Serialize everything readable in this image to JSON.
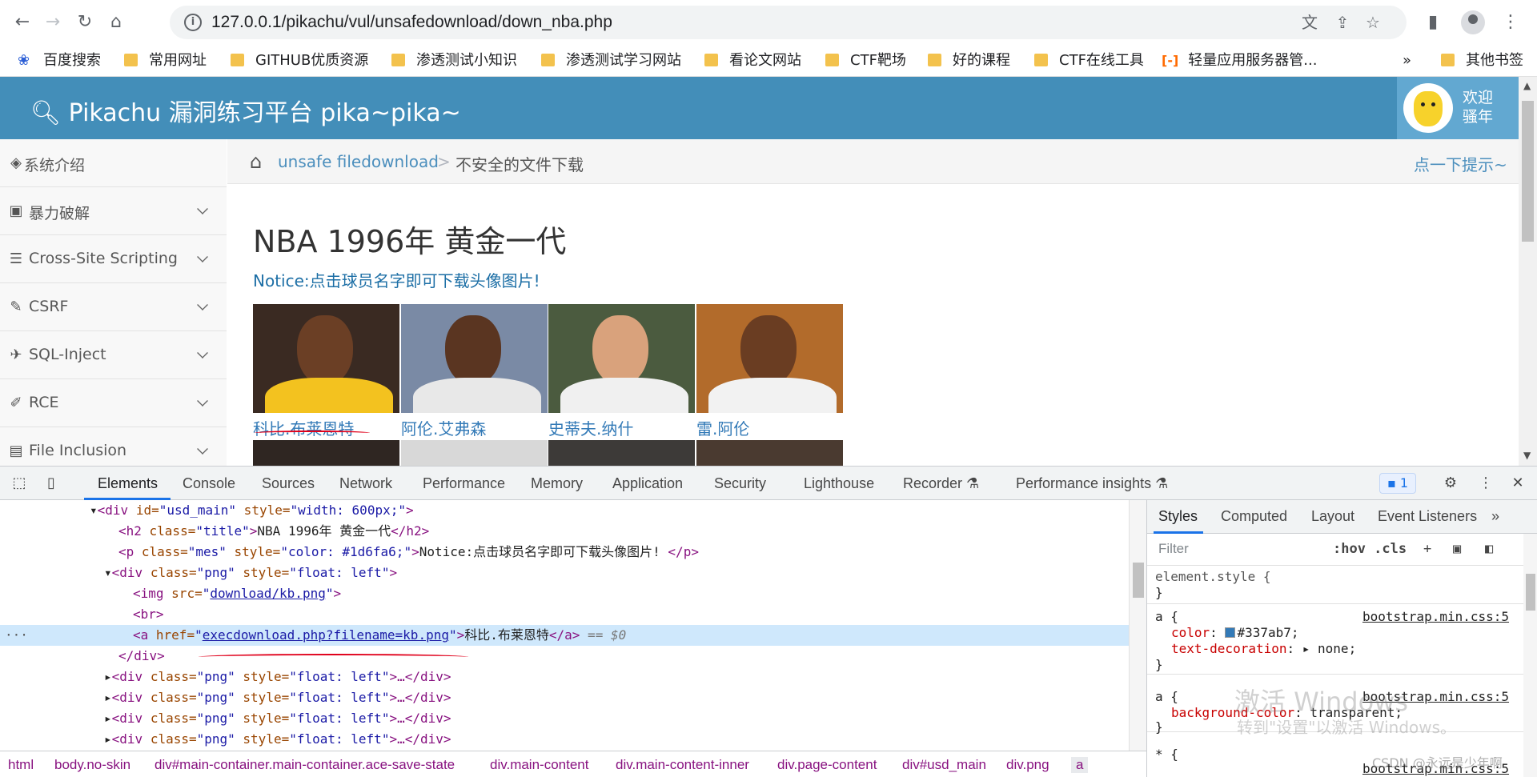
{
  "browser": {
    "url": "127.0.0.1/pikachu/vul/unsafedownload/down_nba.php",
    "bookmarks": [
      "百度搜索",
      "常用网址",
      "GITHUB优质资源",
      "渗透测试小知识",
      "渗透测试学习网站",
      "看论文网站",
      "CTF靶场",
      "好的课程",
      "CTF在线工具",
      "轻量应用服务器管...",
      "其他书签"
    ],
    "more_label": "»"
  },
  "site": {
    "title": "Pikachu 漏洞练习平台 pika~pika~",
    "welcome": "欢迎 骚年",
    "sidebar": [
      "系统介绍",
      "暴力破解",
      "Cross-Site Scripting",
      "CSRF",
      "SQL-Inject",
      "RCE",
      "File Inclusion"
    ],
    "breadcrumb": {
      "section": "unsafe filedownload",
      "sep": ">",
      "page": "不安全的文件下载",
      "hint": "点一下提示~"
    },
    "heading": "NBA 1996年 黄金一代",
    "notice": "Notice:点击球员名字即可下载头像图片!",
    "players": [
      "科比.布莱恩特",
      "阿伦.艾弗森",
      "史蒂夫.纳什",
      "雷.阿伦"
    ]
  },
  "devtools": {
    "tabs": [
      "Elements",
      "Console",
      "Sources",
      "Network",
      "Performance",
      "Memory",
      "Application",
      "Security",
      "Lighthouse",
      "Recorder",
      "Performance insights"
    ],
    "issues_count": "1",
    "dom": {
      "l1_tag": "<div ",
      "l1_attr1": "id=",
      "l1_val1": "\"usd_main\"",
      "l1_attr2": " style=",
      "l1_val2": "\"width: 600px;\"",
      "l1_end": ">",
      "l2_open": "<h2 ",
      "l2_attr": "class=",
      "l2_val": "\"title\"",
      "l2_gt": ">",
      "l2_text": "NBA 1996年 黄金一代",
      "l2_close": "</h2>",
      "l3_open": "<p ",
      "l3_attr1": "class=",
      "l3_val1": "\"mes\"",
      "l3_attr2": " style=",
      "l3_val2": "\"color: #1d6fa6;\"",
      "l3_gt": ">",
      "l3_text": "Notice:点击球员名字即可下载头像图片! ",
      "l3_close": "</p>",
      "l4_open": "<div ",
      "l4_attr1": "class=",
      "l4_val1": "\"png\"",
      "l4_attr2": " style=",
      "l4_val2": "\"float: left\"",
      "l4_gt": ">",
      "l5_open": "<img ",
      "l5_attr": "src=",
      "l5_q1": "\"",
      "l5_link": "download/kb.png",
      "l5_q2": "\"",
      "l5_gt": ">",
      "l6": "<br>",
      "l7_open": "<a ",
      "l7_attr": "href=",
      "l7_q1": "\"",
      "l7_link": "execdownload.php?filename=kb.png",
      "l7_q2": "\"",
      "l7_gt": ">",
      "l7_text": "科比.布莱恩特",
      "l7_close": "</a>",
      "l7_sel": " == $0",
      "l8": "</div>",
      "collapsed_open": "<div ",
      "collapsed_attr1": "class=",
      "collapsed_val1": "\"png\"",
      "collapsed_attr2": " style=",
      "collapsed_val2": "\"float: left\"",
      "collapsed_rest": ">…</div>",
      "ellipsis": "···"
    },
    "crumbs": [
      "html",
      "body.no-skin",
      "div#main-container.main-container.ace-save-state",
      "div.main-content",
      "div.main-content-inner",
      "div.page-content",
      "div#usd_main",
      "div.png",
      "a"
    ],
    "styles_tabs": [
      "Styles",
      "Computed",
      "Layout",
      "Event Listeners",
      "»"
    ],
    "filter_placeholder": "Filter",
    "filter_tools": ":hov .cls",
    "rules": {
      "r1_sel": "element.style {",
      "r1_end": "}",
      "r2_sel": "a {",
      "r2_src": "bootstrap.min.css:5",
      "r2_p1": "color",
      "r2_v1": "#337ab7;",
      "r2_p2": "text-decoration",
      "r2_v2": "none;",
      "r2_end": "}",
      "r3_sel": "a {",
      "r3_src": "bootstrap.min.css:5",
      "r3_p1": "background-color",
      "r3_v1": "transparent;",
      "r3_end": "}",
      "r4_sel": "* {",
      "r4_src": "bootstrap.min.css:5"
    }
  },
  "watermark": {
    "line1": "激活 Windows",
    "line2": "转到\"设置\"以激活 Windows。",
    "csdn": "CSDN @永远是少年啊"
  },
  "colors": {
    "header": "#438eb9",
    "link": "#337ab7",
    "notice": "#1d6fa6",
    "accent": "#1a73e8"
  },
  "icons": [
    "back-icon",
    "forward-icon",
    "reload-icon",
    "home-icon",
    "info-icon",
    "translate-icon",
    "share-icon",
    "star-icon",
    "sidebar-icon",
    "profile-icon",
    "menu-icon",
    "search-key-icon",
    "gear-icon",
    "close-icon",
    "inspect-icon",
    "device-icon"
  ]
}
